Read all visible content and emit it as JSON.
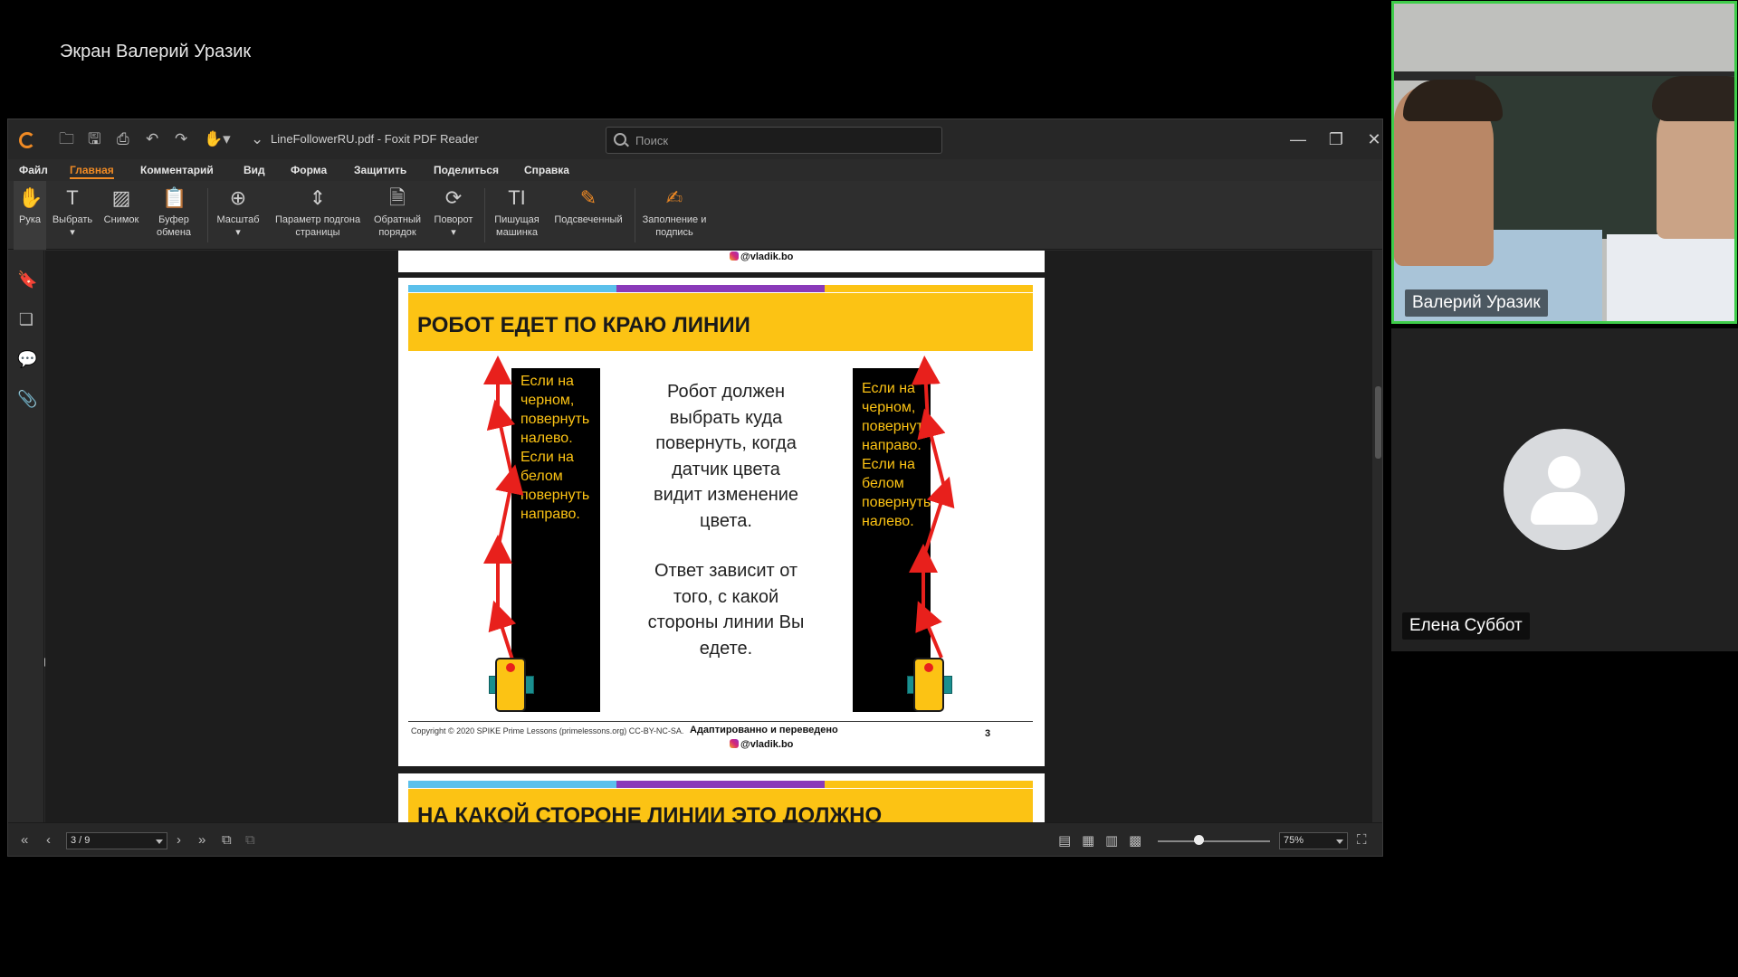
{
  "share_title": "Экран Валерий Уразик",
  "window": {
    "title": "LineFollowerRU.pdf - Foxit PDF Reader",
    "search_placeholder": "Поиск"
  },
  "menu": {
    "items": [
      "Файл",
      "Главная",
      "Комментарий",
      "Вид",
      "Форма",
      "Защитить",
      "Поделиться",
      "Справка"
    ],
    "active": "Главная"
  },
  "ribbon": {
    "tools": [
      {
        "label": "Рука",
        "icon": "hand-icon"
      },
      {
        "label": "Выбрать",
        "icon": "select-text-icon"
      },
      {
        "label": "Снимок",
        "icon": "snapshot-icon"
      },
      {
        "label": "Буфер обмена",
        "icon": "clipboard-icon"
      },
      {
        "label": "Масштаб",
        "icon": "zoom-icon"
      },
      {
        "label": "Параметр подгона страницы",
        "icon": "fit-page-icon"
      },
      {
        "label": "Обратный порядок",
        "icon": "reverse-order-icon"
      },
      {
        "label": "Поворот",
        "icon": "rotate-icon"
      },
      {
        "label": "Пишущая машинка",
        "icon": "typewriter-icon"
      },
      {
        "label": "Подсвеченный",
        "icon": "highlight-icon"
      },
      {
        "label": "Заполнение и подпись",
        "icon": "fill-sign-icon"
      }
    ]
  },
  "pdf": {
    "watermark": "@vladik.bo",
    "slide": {
      "title": "РОБОТ ЕДЕТ ПО КРАЮ ЛИНИИ",
      "left_strip_text": [
        "Если на",
        "черном,",
        "повернуть",
        "налево.",
        "Если на",
        "белом",
        "повернуть",
        "направо."
      ],
      "right_strip_text": [
        "Если на",
        "черном,",
        "повернуть",
        "направо.",
        "Если на",
        "белом",
        "повернуть",
        "налево."
      ],
      "middle_text_1": [
        "Робот должен",
        "выбрать куда",
        "повернуть, когда",
        "датчик цвета",
        "видит изменение",
        "цвета."
      ],
      "middle_text_2": [
        "Ответ зависит от",
        "того, с какой",
        "стороны линии Вы",
        "едете."
      ],
      "copyright": "Copyright © 2020 SPIKE Prime Lessons (primelessons.org) CC-BY-NC-SA.",
      "adapted": "Адаптированно и переведено",
      "page_number": "3"
    },
    "next_slide_title": "НА КАКОЙ СТОРОНЕ ЛИНИИ ЭТО ДОЛЖНО НАЧИНАТЬСЯ",
    "stripe_colors": [
      "#5bc0eb",
      "#8a3ab9",
      "#fcc314"
    ]
  },
  "status": {
    "page": "3 / 9",
    "zoom": "75%"
  },
  "participants": [
    {
      "name": "Валерий Уразик",
      "speaking": true
    },
    {
      "name": "Елена Суббот",
      "speaking": false
    }
  ],
  "colors": {
    "accent": "#f08a24",
    "speaker_border": "#3fcc4a",
    "slide_yellow": "#fcc314",
    "arrow_red": "#e8201c"
  }
}
